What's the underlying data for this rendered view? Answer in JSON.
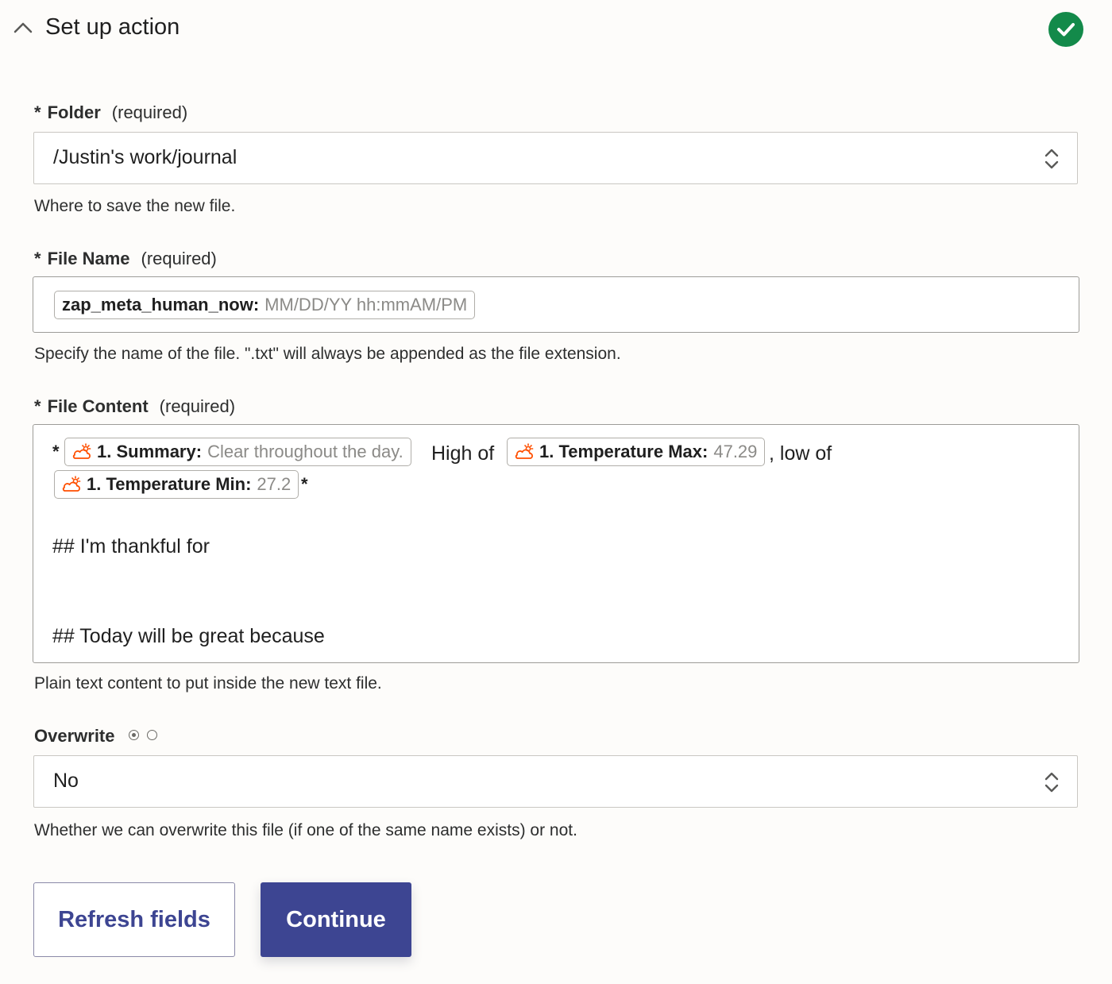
{
  "header": {
    "title": "Set up action",
    "status": "complete"
  },
  "fields": {
    "folder": {
      "star": "*",
      "label": "Folder",
      "required": "(required)",
      "value": "/Justin's work/journal",
      "help": "Where to save the new file."
    },
    "file_name": {
      "star": "*",
      "label": "File Name",
      "required": "(required)",
      "pill": {
        "key": "zap_meta_human_now:",
        "value": "MM/DD/YY hh:mmAM/PM"
      },
      "help": "Specify the name of the file. \".txt\" will always be appended as the file extension."
    },
    "file_content": {
      "star": "*",
      "label": "File Content",
      "required": "(required)",
      "lead_star": "*",
      "pills": [
        {
          "key": "1. Summary:",
          "value": "Clear throughout the day."
        },
        {
          "key": "1. Temperature Max:",
          "value": "47.29"
        },
        {
          "key": "1. Temperature Min:",
          "value": "27.2"
        }
      ],
      "text_high_of": "High of",
      "text_low_of": ", low of",
      "trail_star": "*",
      "line_thankful": "## I'm thankful for",
      "line_great": "## Today will be great because",
      "help": "Plain text content to put inside the new text file."
    },
    "overwrite": {
      "label": "Overwrite",
      "value": "No",
      "help": "Whether we can overwrite this file (if one of the same name exists) or not."
    }
  },
  "buttons": {
    "refresh": "Refresh fields",
    "continue": "Continue"
  },
  "colors": {
    "accent": "#3d4592",
    "success": "#138a4a",
    "icon": "#ff4f00"
  }
}
